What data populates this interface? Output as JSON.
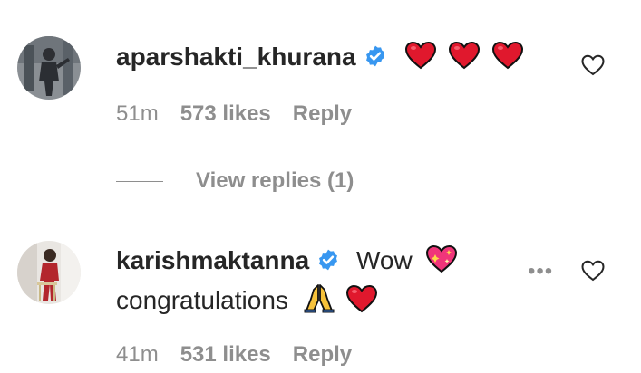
{
  "comments": [
    {
      "username": "aparshakti_khurana",
      "verified": true,
      "text": "",
      "emojis": [
        "red-heart",
        "red-heart",
        "red-heart"
      ],
      "time": "51m",
      "likes": "573 likes",
      "reply": "Reply",
      "view_replies": "View replies (1)"
    },
    {
      "username": "karishmaktanna",
      "verified": true,
      "text_before": "Wow",
      "text_line2": "congratulations",
      "time": "41m",
      "likes": "531 likes",
      "reply": "Reply"
    }
  ],
  "more_label": "•••",
  "colors": {
    "text": "#262626",
    "muted": "#8e8e8e",
    "verified": "#3897f0",
    "heart_emoji": "#e0182d"
  },
  "icons": {
    "like": "heart-outline-icon",
    "verified": "verified-badge-icon",
    "more": "more-options-icon"
  }
}
